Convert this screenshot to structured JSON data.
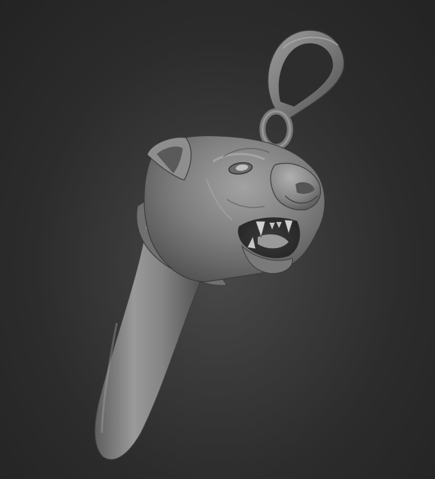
{
  "scene": {
    "subject": "",
    "background_color": "#2b2b2b",
    "material_color": "#8a8a8a"
  }
}
